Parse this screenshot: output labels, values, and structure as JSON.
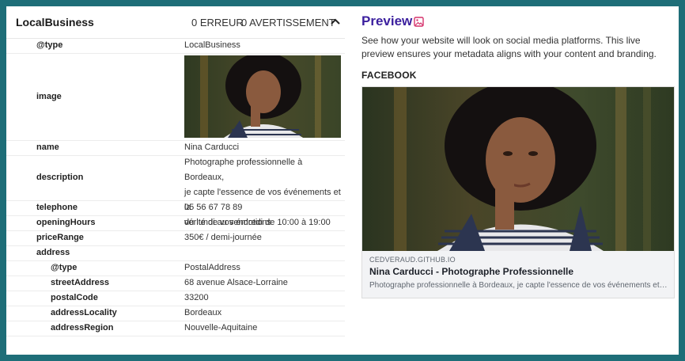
{
  "schema_panel": {
    "title": "LocalBusiness",
    "errors_label": "0 ERREUR",
    "warnings_label": "0 AVERTISSEMENT",
    "rows": [
      {
        "key": "@type",
        "value": "LocalBusiness"
      },
      {
        "key": "image",
        "value": ""
      },
      {
        "key": "name",
        "value": "Nina Carducci"
      },
      {
        "key": "description",
        "value": "Photographe professionnelle à Bordeaux, je capte l'essence de vos événements et la vérité de vos émotions"
      },
      {
        "key": "telephone",
        "value": "05 56 67 78 89"
      },
      {
        "key": "openingHours",
        "value": "du lundi au vendredi de 10:00 à 19:00"
      },
      {
        "key": "priceRange",
        "value": "350€ / demi-journée"
      },
      {
        "key": "address",
        "value": ""
      },
      {
        "key": "@type",
        "value": "PostalAddress"
      },
      {
        "key": "streetAddress",
        "value": "68 avenue Alsace-Lorraine"
      },
      {
        "key": "postalCode",
        "value": "33200"
      },
      {
        "key": "addressLocality",
        "value": "Bordeaux"
      },
      {
        "key": "addressRegion",
        "value": "Nouvelle-Aquitaine"
      }
    ],
    "description_lines": [
      "Photographe professionnelle à Bordeaux,",
      "je capte l'essence de vos événements et la",
      "vérité de vos émotions"
    ]
  },
  "preview": {
    "title": "Preview",
    "icon": "image-icon",
    "description": "See how your website will look on social media platforms. This live preview ensures your metadata aligns with your content and branding.",
    "facebook_label": "FACEBOOK",
    "card": {
      "domain": "CEDVERAUD.GITHUB.IO",
      "title": "Nina Carducci - Photographe Professionnelle",
      "description": "Photographe professionnelle à Bordeaux, je capte l'essence de vos événements et la vér..."
    }
  },
  "colors": {
    "frame_border": "#1e6e78",
    "preview_accent": "#3b1f9e",
    "icon_pink": "#d6336c"
  }
}
